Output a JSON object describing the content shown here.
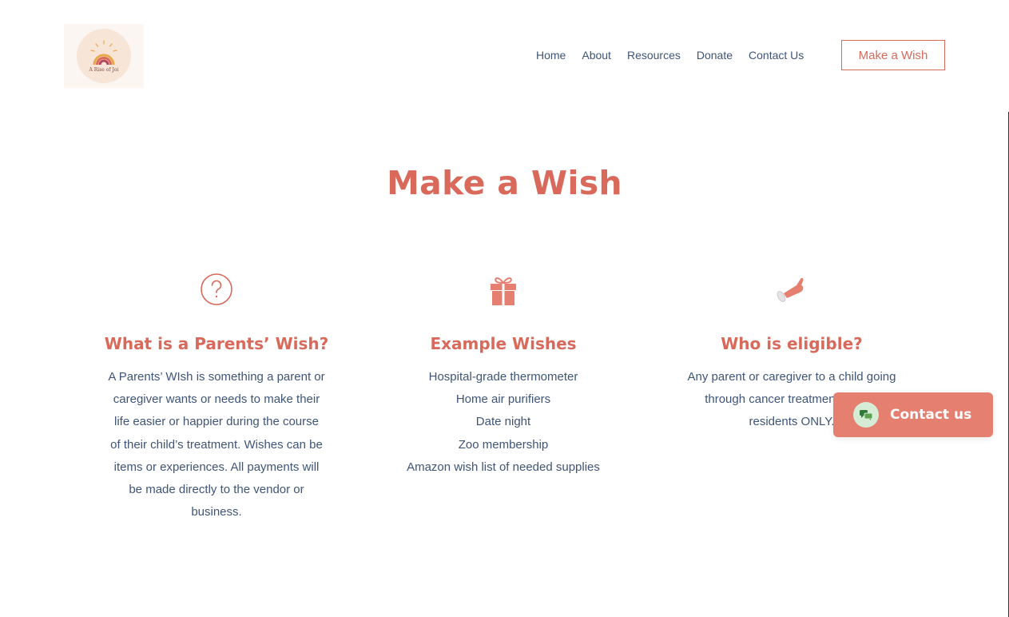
{
  "header": {
    "logo_text": "A Rise of Joi",
    "nav": [
      "Home",
      "About",
      "Resources",
      "Donate",
      "Contact Us"
    ],
    "cta_label": "Make a Wish"
  },
  "hero": {
    "title": "Make a Wish"
  },
  "columns": [
    {
      "icon": "question-circle-icon",
      "heading": "What is a Parents’ Wish?",
      "lines": [
        "A Parents’ WIsh is something a parent or",
        "caregiver wants or needs to make their",
        "life easier or happier during the course",
        "of their child’s treatment. Wishes can be",
        "items or experiences. All payments will",
        "be made directly to the vendor or",
        "business."
      ]
    },
    {
      "icon": "gift-icon",
      "heading": "Example Wishes",
      "lines": [
        "Hospital-grade thermometer",
        "Home air purifiers",
        "Date night",
        "Zoo membership",
        "Amazon wish list of needed supplies"
      ]
    },
    {
      "icon": "hand-pointer-icon",
      "heading": "Who is eligible?",
      "lines": [
        "Any parent or caregiver to a child going",
        "through cancer treatment. Illinois",
        "residents ONLY."
      ]
    }
  ],
  "chat": {
    "label": "Contact us",
    "icon": "chat-bubbles-icon"
  },
  "colors": {
    "accent": "#d9695b",
    "text": "#3e5578",
    "chat_bg": "#e57f70"
  }
}
